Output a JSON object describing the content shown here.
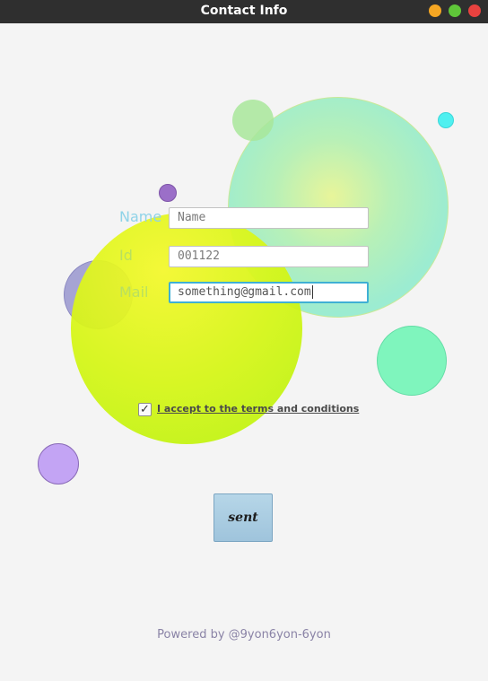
{
  "window": {
    "title": "Contact Info",
    "buttons": [
      {
        "name": "minimize",
        "color": "#f5a623"
      },
      {
        "name": "maximize",
        "color": "#5fc639"
      },
      {
        "name": "close",
        "color": "#e8423f"
      }
    ]
  },
  "form": {
    "name_label": "Name",
    "name_placeholder": "Name",
    "id_label": "Id",
    "id_value": "001122",
    "mail_label": "Mail",
    "mail_value": "something@gmail.com",
    "label_colors": {
      "name": "#8fd3e8",
      "id": "#b8e060",
      "mail": "#b8e060"
    },
    "focus_color": "#3fb0d4"
  },
  "terms": {
    "checked": true,
    "check_glyph": "✓",
    "label": "I accept to the terms and conditions"
  },
  "submit": {
    "label": "sent"
  },
  "footer": {
    "text": "Powered by @9yon6yon-6yon"
  }
}
